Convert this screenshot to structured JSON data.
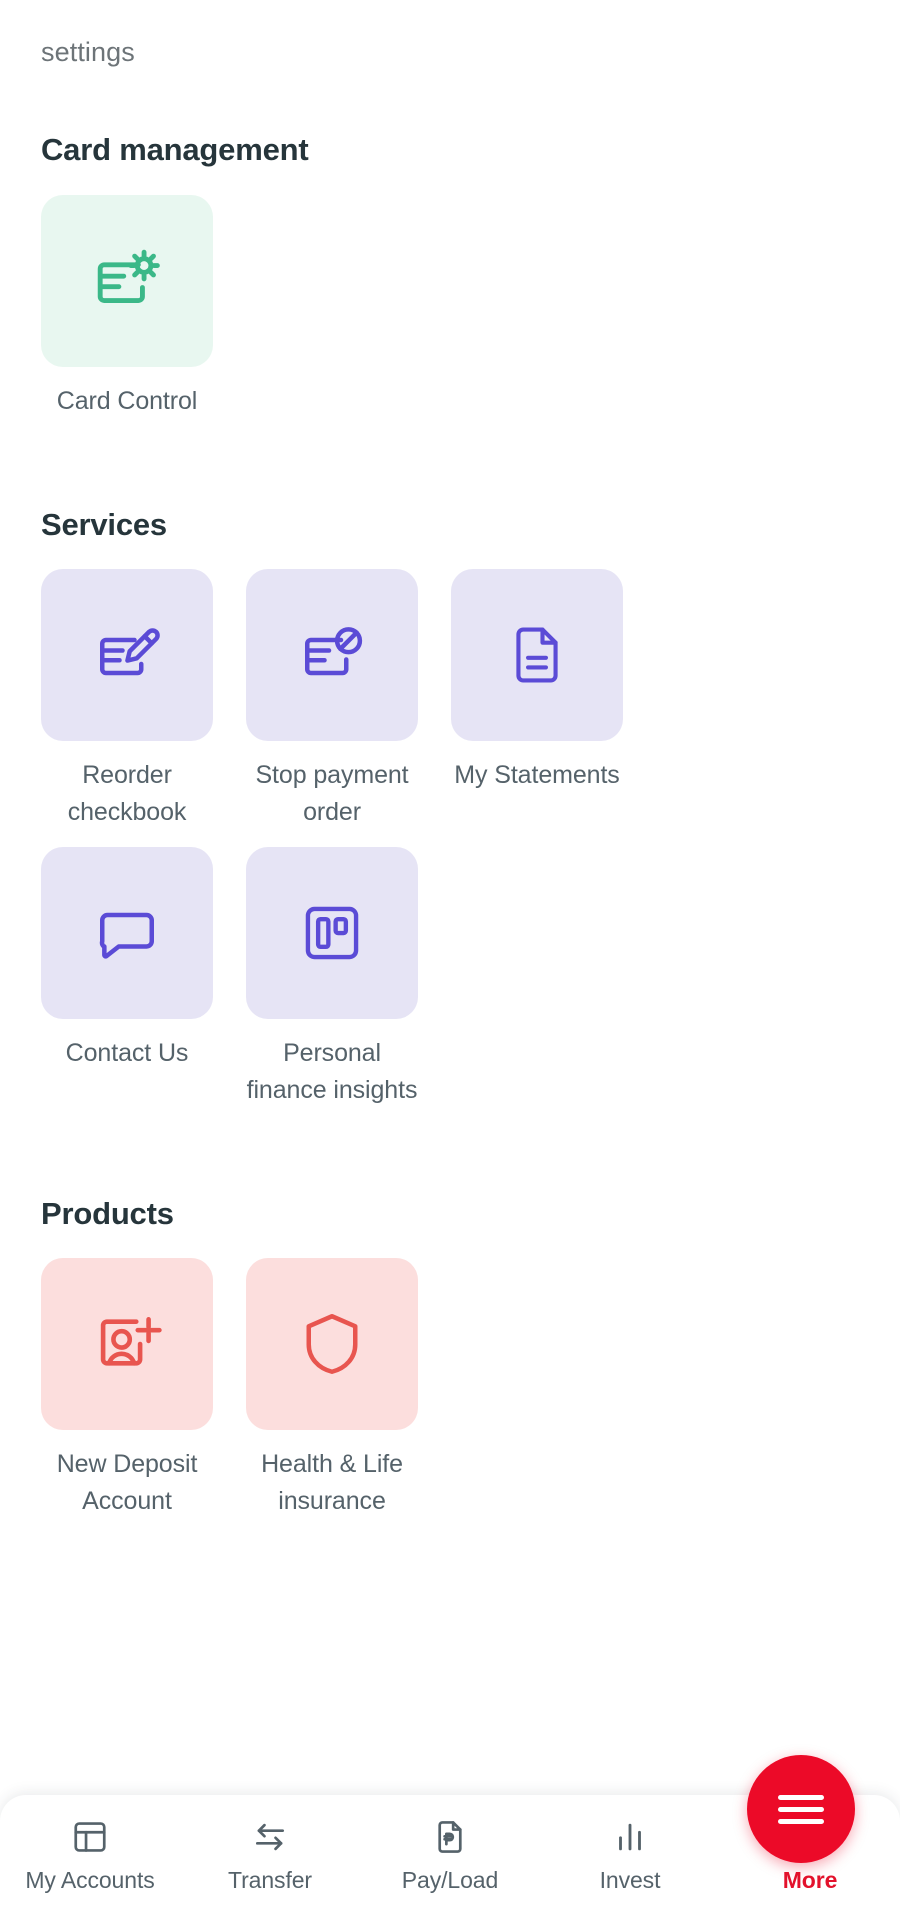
{
  "screen": {
    "partial_heading": "settings",
    "accent_green": "#3bb888",
    "accent_purple": "#5b4bd6",
    "accent_red": "#e8554f",
    "brand_red": "#ec0a28",
    "title_color": "#26353b",
    "label_color": "#55626a"
  },
  "sections": [
    {
      "id": "card-management",
      "title": "Card management",
      "tiles": [
        {
          "label": "Card Control",
          "icon": "card-gear-icon",
          "theme": "green"
        }
      ]
    },
    {
      "id": "services",
      "title": "Services",
      "tiles": [
        {
          "label": "Reorder checkbook",
          "icon": "check-pen-icon",
          "theme": "purple"
        },
        {
          "label": "Stop payment order",
          "icon": "check-ban-icon",
          "theme": "purple"
        },
        {
          "label": "My Statements",
          "icon": "document-icon",
          "theme": "purple"
        },
        {
          "label": "Contact Us",
          "icon": "chat-bubble-icon",
          "theme": "purple"
        },
        {
          "label": "Personal finance insights",
          "icon": "board-columns-icon",
          "theme": "purple"
        }
      ]
    },
    {
      "id": "products",
      "title": "Products",
      "tiles": [
        {
          "label": "New Deposit Account",
          "icon": "user-add-icon",
          "theme": "red"
        },
        {
          "label": "Health & Life insurance",
          "icon": "shield-icon",
          "theme": "red"
        }
      ]
    }
  ],
  "bottom_nav": {
    "items": [
      {
        "label": "My Accounts",
        "icon": "dashboard-icon",
        "active": false
      },
      {
        "label": "Transfer",
        "icon": "transfer-arrows-icon",
        "active": false
      },
      {
        "label": "Pay/Load",
        "icon": "peso-document-icon",
        "active": false
      },
      {
        "label": "Invest",
        "icon": "bar-chart-icon",
        "active": false
      },
      {
        "label": "More",
        "icon": "hamburger-icon",
        "active": true
      }
    ]
  }
}
